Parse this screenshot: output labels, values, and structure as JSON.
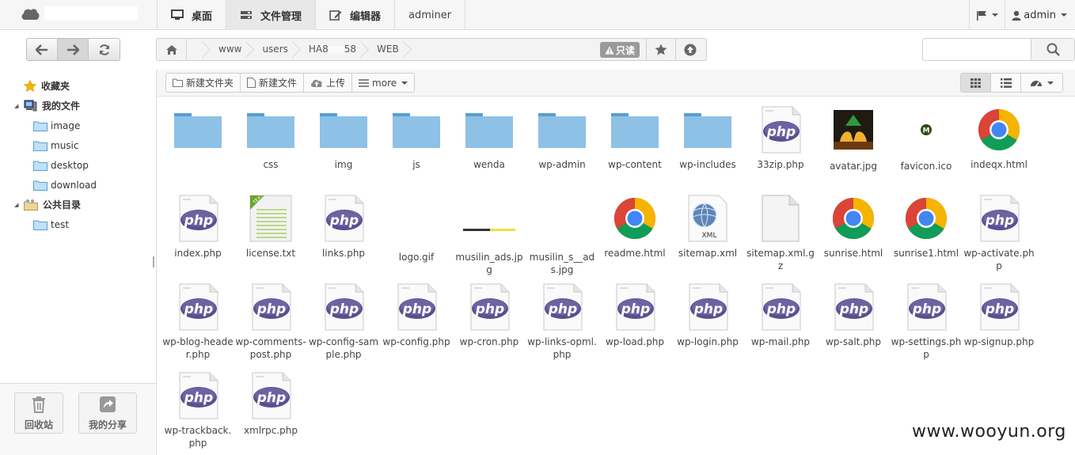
{
  "topbar": {
    "menu": [
      {
        "label": "桌面",
        "icon": "monitor-icon"
      },
      {
        "label": "文件管理",
        "icon": "hdd-icon"
      },
      {
        "label": "编辑器",
        "icon": "edit-icon"
      },
      {
        "label": "adminer"
      }
    ],
    "user": "admin"
  },
  "address": {
    "crumbs": [
      "www",
      "users",
      "HA8",
      "58",
      "WEB"
    ],
    "readonly_label": "只读",
    "search_placeholder": ""
  },
  "sidebar": {
    "tree": [
      {
        "label": "收藏夹",
        "type": "root",
        "icon": "star-icon"
      },
      {
        "label": "我的文件",
        "type": "root",
        "icon": "computer-icon"
      },
      {
        "label": "image",
        "type": "folder"
      },
      {
        "label": "music",
        "type": "folder"
      },
      {
        "label": "desktop",
        "type": "folder"
      },
      {
        "label": "download",
        "type": "folder"
      },
      {
        "label": "公共目录",
        "type": "root",
        "icon": "group-folder-icon"
      },
      {
        "label": "test",
        "type": "folder"
      }
    ],
    "recycle_label": "回收站",
    "share_label": "我的分享"
  },
  "toolbar": {
    "new_folder": "新建文件夹",
    "new_file": "新建文件",
    "upload": "上传",
    "more": "more"
  },
  "files": [
    {
      "name": "",
      "type": "folder"
    },
    {
      "name": "css",
      "type": "folder"
    },
    {
      "name": "img",
      "type": "folder"
    },
    {
      "name": "js",
      "type": "folder"
    },
    {
      "name": "wenda",
      "type": "folder"
    },
    {
      "name": "wp-admin",
      "type": "folder"
    },
    {
      "name": "wp-content",
      "type": "folder"
    },
    {
      "name": "wp-includes",
      "type": "folder"
    },
    {
      "name": "33zip.php",
      "type": "php"
    },
    {
      "name": "avatar.jpg",
      "type": "image-hands"
    },
    {
      "name": "favicon.ico",
      "type": "favicon"
    },
    {
      "name": "indeqx.html",
      "type": "chrome"
    },
    {
      "name": "index.php",
      "type": "php"
    },
    {
      "name": "license.txt",
      "type": "text"
    },
    {
      "name": "links.php",
      "type": "php"
    },
    {
      "name": "logo.gif",
      "type": "blank"
    },
    {
      "name": "musilin_ads.jpg",
      "type": "banner"
    },
    {
      "name": "musilin_s__ads.jpg",
      "type": "blank"
    },
    {
      "name": "readme.html",
      "type": "chrome"
    },
    {
      "name": "sitemap.xml",
      "type": "xml"
    },
    {
      "name": "sitemap.xml.gz",
      "type": "doc"
    },
    {
      "name": "sunrise.html",
      "type": "chrome"
    },
    {
      "name": "sunrise1.html",
      "type": "chrome"
    },
    {
      "name": "wp-activate.php",
      "type": "php"
    },
    {
      "name": "wp-blog-header.php",
      "type": "php"
    },
    {
      "name": "wp-comments-post.php",
      "type": "php"
    },
    {
      "name": "wp-config-sample.php",
      "type": "php"
    },
    {
      "name": "wp-config.php",
      "type": "php"
    },
    {
      "name": "wp-cron.php",
      "type": "php"
    },
    {
      "name": "wp-links-opml.php",
      "type": "php"
    },
    {
      "name": "wp-load.php",
      "type": "php"
    },
    {
      "name": "wp-login.php",
      "type": "php"
    },
    {
      "name": "wp-mail.php",
      "type": "php"
    },
    {
      "name": "wp-salt.php",
      "type": "php"
    },
    {
      "name": "wp-settings.php",
      "type": "php"
    },
    {
      "name": "wp-signup.php",
      "type": "php"
    },
    {
      "name": "wp-trackback.php",
      "type": "php"
    },
    {
      "name": "xmlrpc.php",
      "type": "php"
    }
  ],
  "watermark": "www.wooyun.org",
  "colors": {
    "folder": "#8ec1e6",
    "folder_tab": "#5a9ed0",
    "php_badge": "#5a4f8f"
  }
}
